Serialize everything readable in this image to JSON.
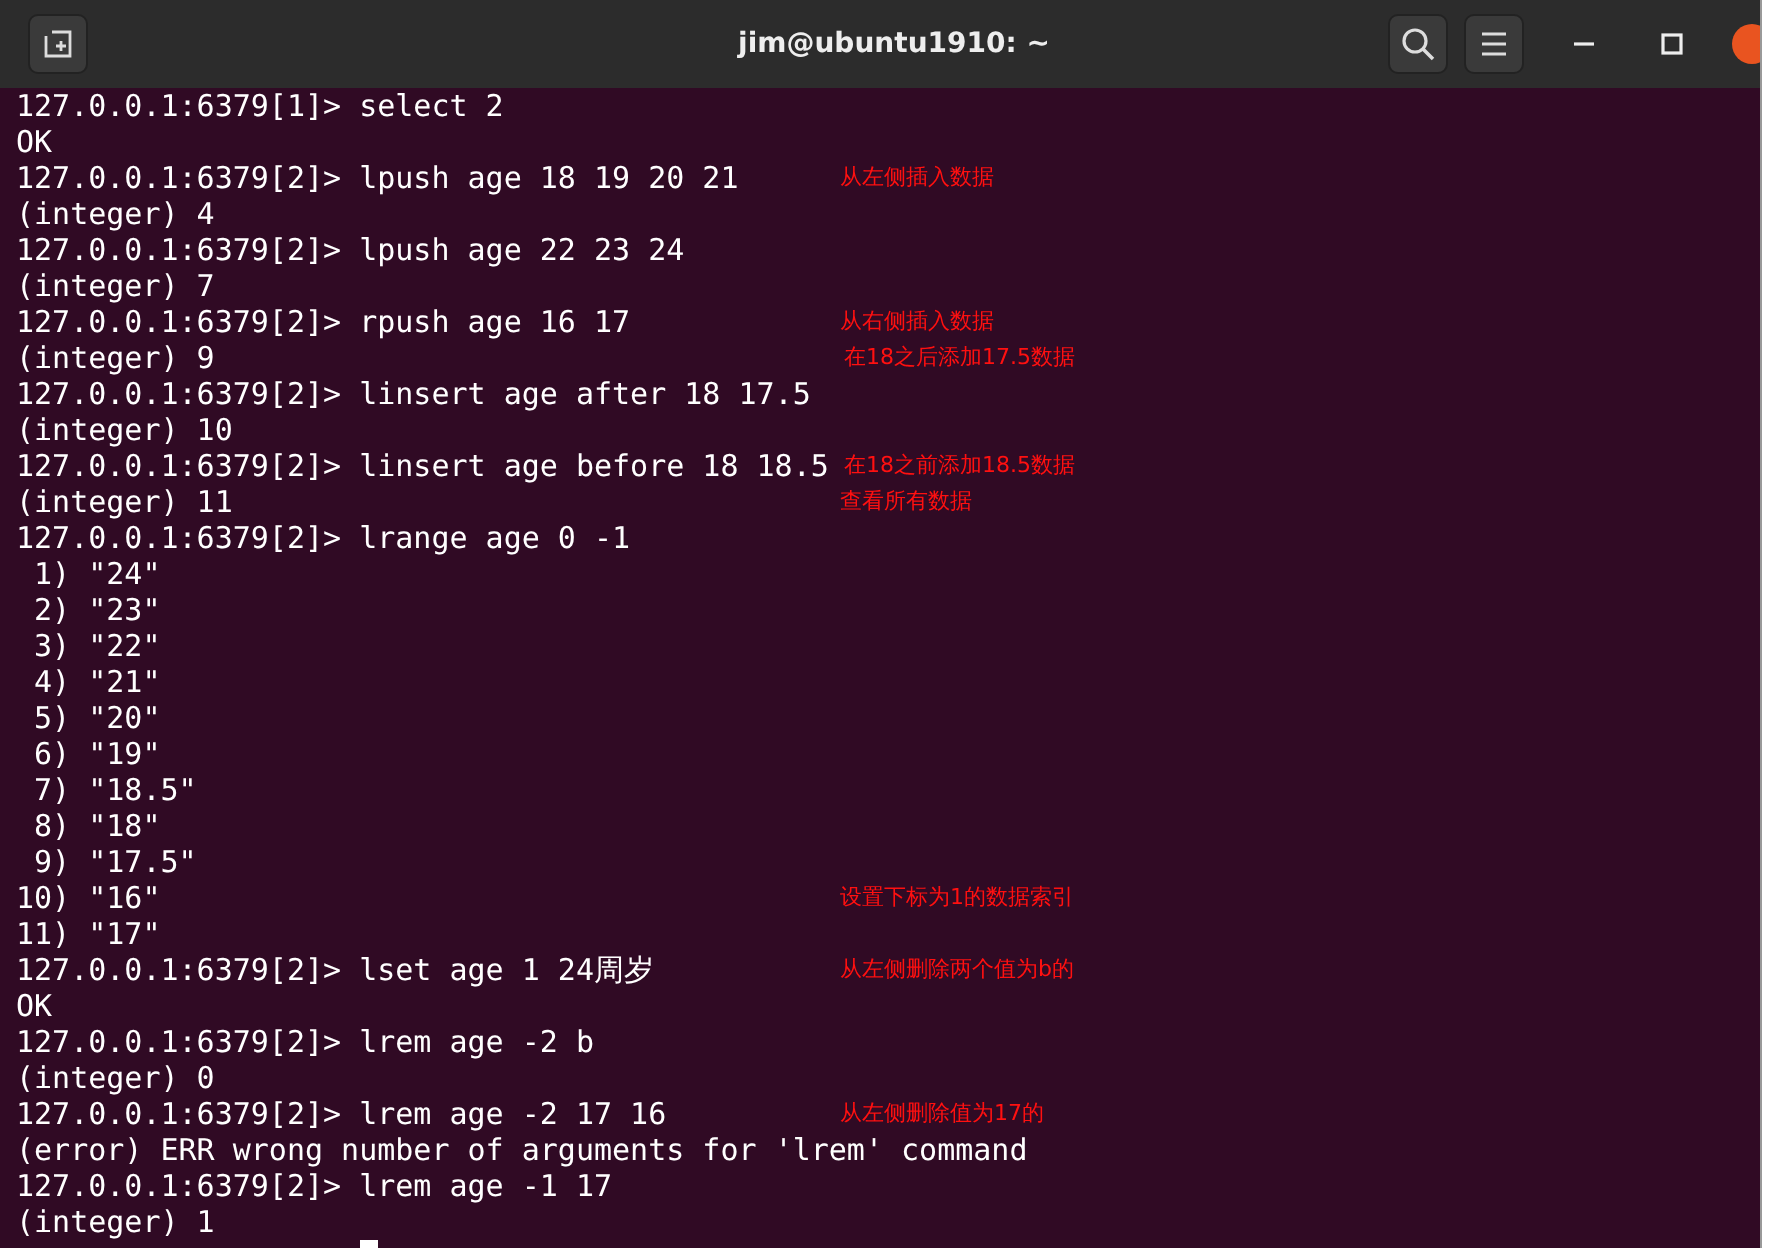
{
  "window": {
    "title": "jim@ubuntu1910: ~"
  },
  "lines": [
    {
      "text": "127.0.0.1:6379[1]> select 2"
    },
    {
      "text": "OK"
    },
    {
      "text": "127.0.0.1:6379[2]> lpush age 18 19 20 21",
      "note": "从左侧插入数据"
    },
    {
      "text": "(integer) 4"
    },
    {
      "text": "127.0.0.1:6379[2]> lpush age 22 23 24"
    },
    {
      "text": "(integer) 7"
    },
    {
      "text": "127.0.0.1:6379[2]> rpush age 16 17",
      "note": "从右侧插入数据"
    },
    {
      "text": "(integer) 9",
      "note": "在18之后添加17.5数据"
    },
    {
      "text": "127.0.0.1:6379[2]> linsert age after 18 17.5"
    },
    {
      "text": "(integer) 10"
    },
    {
      "text": "127.0.0.1:6379[2]> linsert age before 18 18.5",
      "note": "在18之前添加18.5数据"
    },
    {
      "text": "(integer) 11",
      "note": "查看所有数据"
    },
    {
      "text": "127.0.0.1:6379[2]> lrange age 0 -1"
    },
    {
      "text": " 1) \"24\""
    },
    {
      "text": " 2) \"23\""
    },
    {
      "text": " 3) \"22\""
    },
    {
      "text": " 4) \"21\""
    },
    {
      "text": " 5) \"20\""
    },
    {
      "text": " 6) \"19\""
    },
    {
      "text": " 7) \"18.5\""
    },
    {
      "text": " 8) \"18\""
    },
    {
      "text": " 9) \"17.5\""
    },
    {
      "text": "10) \"16\"",
      "note": "设置下标为1的数据索引"
    },
    {
      "text": "11) \"17\""
    },
    {
      "text": "127.0.0.1:6379[2]> lset age 1 24周岁",
      "note": "从左侧删除两个值为b的"
    },
    {
      "text": "OK"
    },
    {
      "text": "127.0.0.1:6379[2]> lrem age -2 b"
    },
    {
      "text": "(integer) 0"
    },
    {
      "text": "127.0.0.1:6379[2]> lrem age -2 17 16",
      "note": "从左侧删除值为17的"
    },
    {
      "text": "(error) ERR wrong number of arguments for 'lrem' command"
    },
    {
      "text": "127.0.0.1:6379[2]> lrem age -1 17"
    },
    {
      "text": "(integer) 1"
    }
  ]
}
